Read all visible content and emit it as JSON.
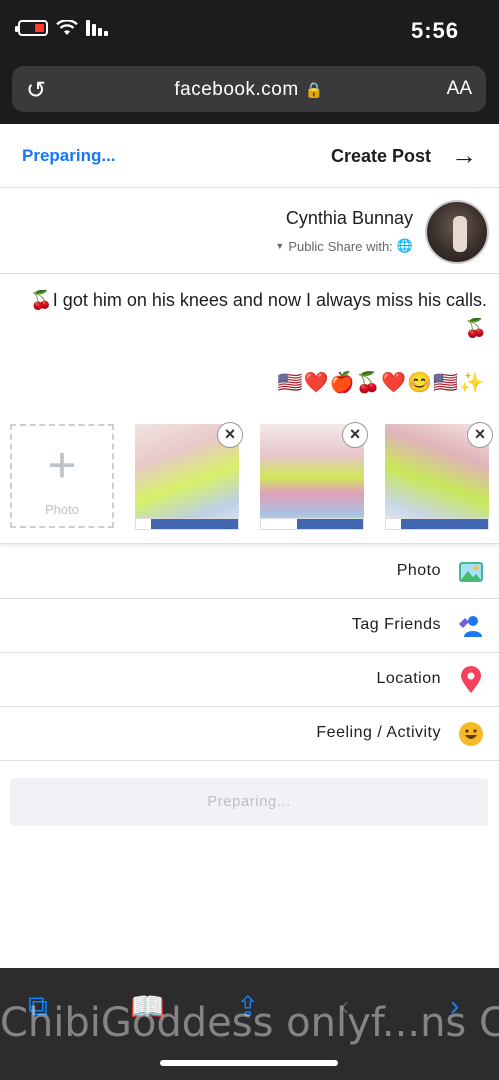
{
  "status_bar": {
    "time": "5:56"
  },
  "browser": {
    "url": "facebook.com",
    "text_size_label": "AA"
  },
  "header": {
    "title": "Create Post",
    "action": "Preparing..."
  },
  "profile": {
    "name": "Cynthia Bunnay",
    "share_prefix": "Share with:",
    "audience": "Public"
  },
  "post": {
    "text": "🍒I got him on his knees and now I always miss his calls. 🍒",
    "emoji_line": "🇺🇸❤️🍎🍒❤️😊🇺🇸✨"
  },
  "photos": {
    "items": [
      {
        "progress": 0.85
      },
      {
        "progress": 0.65
      },
      {
        "progress": 0.85
      }
    ],
    "add_label": "Photo"
  },
  "options": [
    {
      "label": "Photo",
      "icon": "photo-icon"
    },
    {
      "label": "Tag Friends",
      "icon": "tag-friends-icon"
    },
    {
      "label": "Location",
      "icon": "location-pin-icon"
    },
    {
      "label": "Feeling / Activity",
      "icon": "smiley-icon"
    }
  ],
  "submit_button": {
    "label": "Preparing..."
  },
  "watermark": "ChibiGoddess onlyf...ns ChibiGoddess onlyf",
  "colors": {
    "accent": "#1877f2",
    "progress": "#4267b2",
    "browser_chrome": "#1c1c1e"
  }
}
